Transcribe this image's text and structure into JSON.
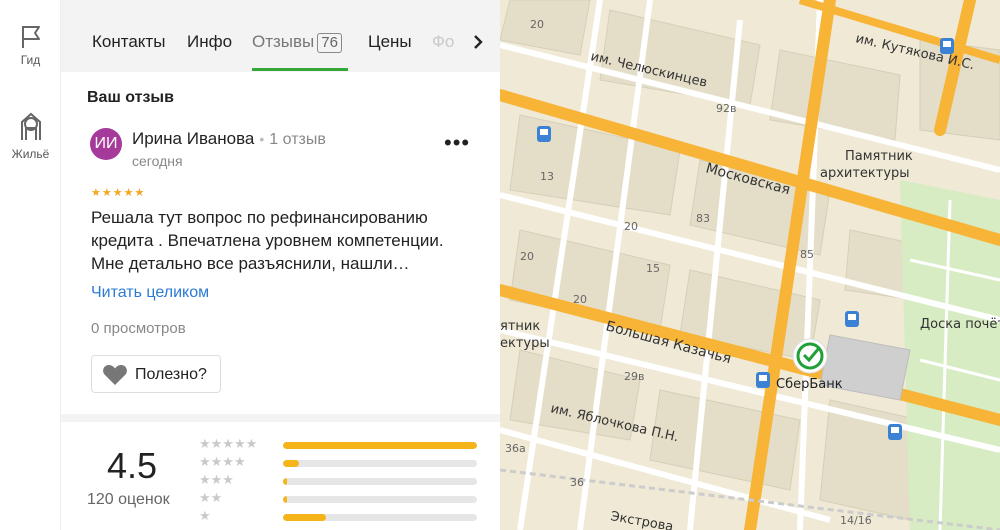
{
  "rail": {
    "items": [
      {
        "label": "Гид",
        "icon": "flag-icon"
      },
      {
        "label": "Жильё",
        "icon": "house-icon"
      }
    ]
  },
  "tabs": {
    "items": [
      {
        "label": "Контакты"
      },
      {
        "label": "Инфо"
      },
      {
        "label": "Отзывы",
        "count": "76",
        "active": true
      },
      {
        "label": "Цены"
      },
      {
        "label": "Фо"
      }
    ]
  },
  "review_section": {
    "title": "Ваш отзыв",
    "avatar_initials": "ИИ",
    "author": "Ирина Иванова",
    "author_reviews": "1 отзыв",
    "date": "сегодня",
    "stars": 5,
    "stars_text": "★★★★★",
    "text": "Решала тут вопрос по рефинансированию кредита . Впечатлена уровнем компетенции. Мне детально все разъяснили, нашли…",
    "read_more": "Читать целиком",
    "views": "0 просмотров",
    "helpful_label": "Полезно?",
    "more_glyph": "•••"
  },
  "summary": {
    "rating": "4.5",
    "ratings_count": "120 оценок",
    "distribution": [
      {
        "stars": 5,
        "stars_text": "★★★★★",
        "fraction": 1.0
      },
      {
        "stars": 4,
        "stars_text": "★★★★",
        "fraction": 0.08
      },
      {
        "stars": 3,
        "stars_text": "★★★",
        "fraction": 0.02
      },
      {
        "stars": 2,
        "stars_text": "★★",
        "fraction": 0.02
      },
      {
        "stars": 1,
        "stars_text": "★",
        "fraction": 0.22
      }
    ]
  },
  "map": {
    "streets": [
      "им. Челюскинцев",
      "им. Кутякова И.С.",
      "Московская",
      "Большая Казачья",
      "им. Яблочкова П.Н.",
      "Экстрова"
    ],
    "labels": [
      "Памятник",
      "архитектуры",
      "Доска почёт",
      "СберБанк",
      "ятник",
      "ектуры"
    ],
    "house_numbers": [
      "92в",
      "83",
      "20",
      "15",
      "20",
      "29в",
      "36а",
      "36",
      "14/16",
      "85",
      "20",
      "13",
      "20"
    ],
    "colors": {
      "road": "#f7b437",
      "land": "#efe9d5",
      "park": "#d7ecc3",
      "block": "#e3ddcb",
      "building": "#d9d2bd"
    }
  },
  "colors": {
    "accent": "#35a83a",
    "star": "#f5a623",
    "link": "#2a7bd4",
    "avatar": "#a63a9a"
  }
}
